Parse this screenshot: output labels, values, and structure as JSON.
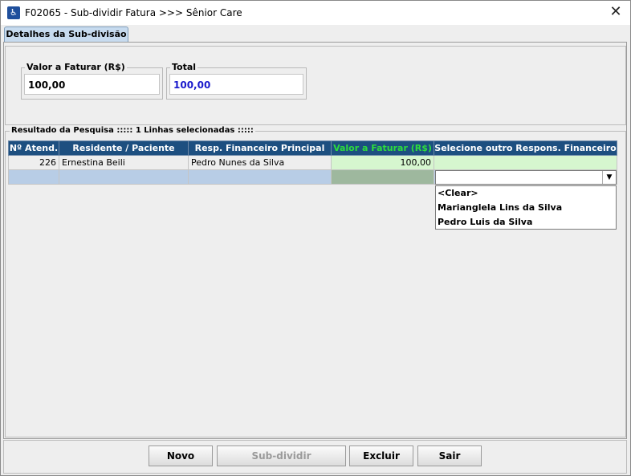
{
  "window": {
    "title": "F02065 - Sub-dividir Fatura >>> Sênior Care",
    "close_glyph": "✕",
    "app_icon": "app-logo-icon"
  },
  "tab": {
    "label": "Detalhes da Sub-divisão"
  },
  "fields": {
    "valor": {
      "label": "Valor a Faturar (R$)",
      "value": "100,00"
    },
    "total": {
      "label": "Total",
      "value": "100,00",
      "color": "#1a1acc"
    }
  },
  "results": {
    "legend": "Resultado da Pesquisa ::::: 1 Linhas selecionadas :::::",
    "columns": [
      "Nº Atend.",
      "Residente / Paciente",
      "Resp. Financeiro Principal",
      "Valor a Faturar (R$)",
      "Selecione outro Respons. Financeiro"
    ],
    "rows": [
      {
        "atend": "226",
        "residente": "Ernestina Beili",
        "resp": "Pedro Nunes da Silva",
        "valor": "100,00",
        "outro": ""
      }
    ],
    "dropdown_options": [
      "<Clear>",
      "Marianglela Lins da Silva",
      "Pedro Luis da Silva"
    ]
  },
  "buttons": {
    "novo": "Novo",
    "subdividir": "Sub-dividir",
    "excluir": "Excluir",
    "sair": "Sair"
  }
}
